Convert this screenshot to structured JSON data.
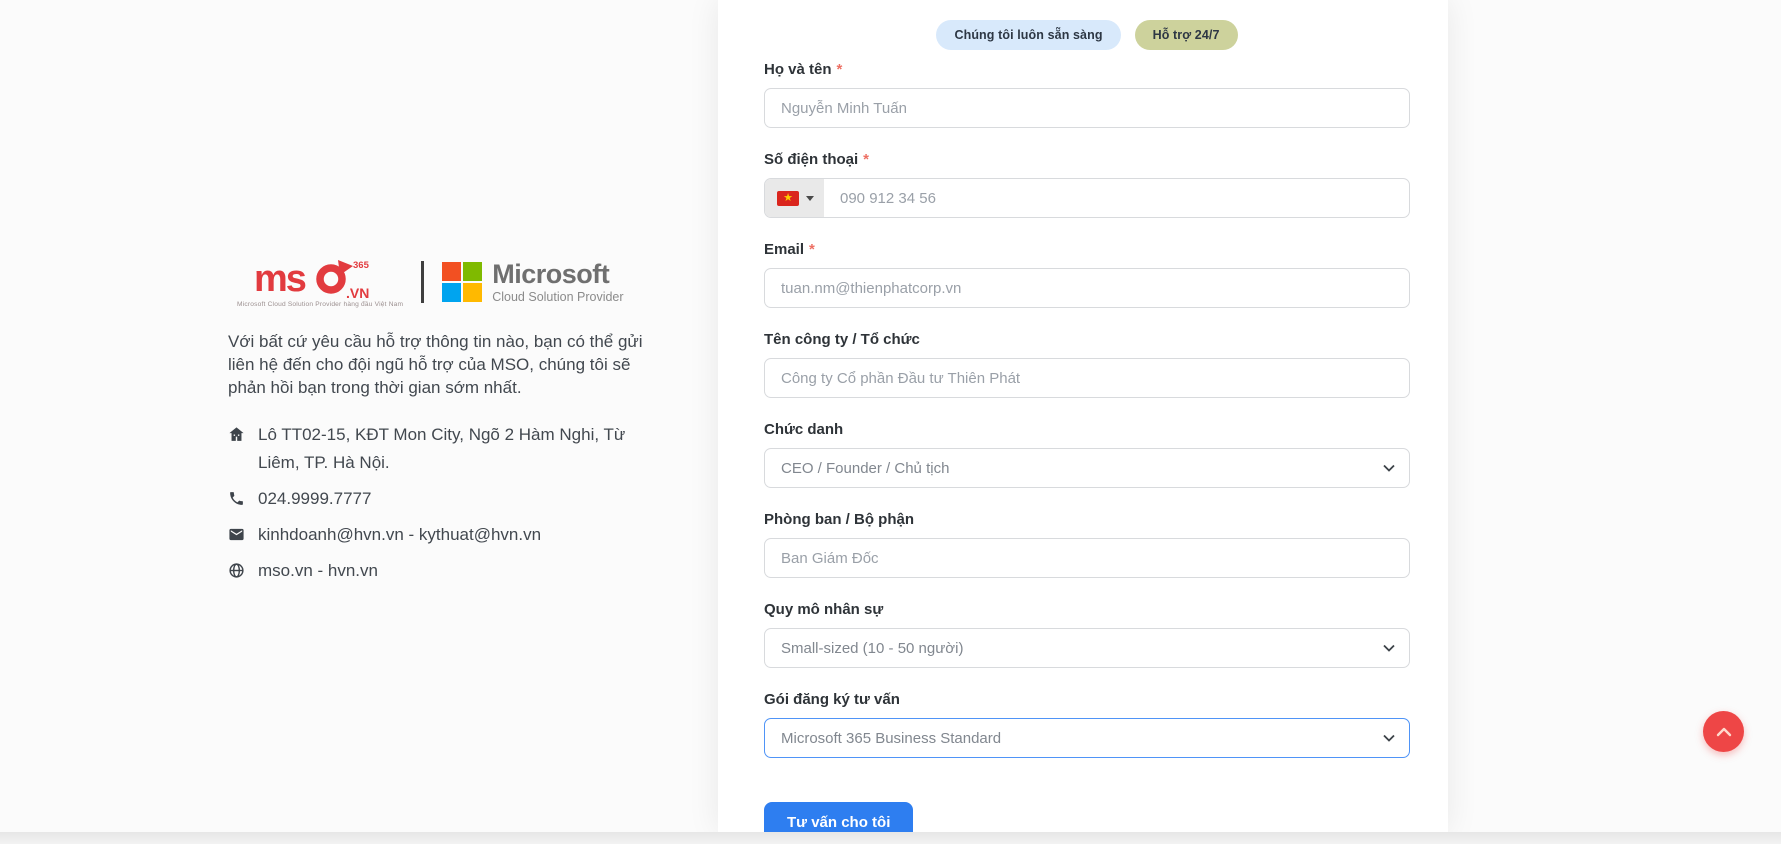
{
  "info_panel": {
    "logo": {
      "mso_text": "ms",
      "mso_365": "365",
      "mso_vn": ".VN",
      "mso_tagline": "Microsoft Cloud Solution Provider hàng đầu Việt Nam",
      "microsoft_name": "Microsoft",
      "microsoft_subtitle": "Cloud Solution Provider",
      "mso_red": "#e23b3f",
      "ms_square_colors": [
        "#f25022",
        "#7fba00",
        "#00a4ef",
        "#ffb900"
      ]
    },
    "description": "Với bất cứ yêu cầu hỗ trợ thông tin nào, bạn có thể gửi liên hệ đến cho đội ngũ hỗ trợ của MSO, chúng tôi sẽ phản hồi bạn trong thời gian sớm nhất.",
    "contacts": [
      {
        "icon": "building-icon",
        "text": "Lô TT02-15, KĐT Mon City, Ngõ 2 Hàm Nghi, Từ Liêm, TP. Hà Nội."
      },
      {
        "icon": "phone-icon",
        "text": "024.9999.7777"
      },
      {
        "icon": "email-icon",
        "text": "kinhdoanh@hvn.vn - kythuat@hvn.vn"
      },
      {
        "icon": "globe-icon",
        "text": "mso.vn - hvn.vn"
      }
    ]
  },
  "form": {
    "required_mark": "*",
    "badges": [
      {
        "label": "Chúng tôi luôn sẵn sàng",
        "bg": "#d8e9fb"
      },
      {
        "label": "Hỗ trợ 24/7",
        "bg": "#cdd29c"
      }
    ],
    "fields": [
      {
        "type": "text",
        "label": "Họ và tên",
        "required": true,
        "placeholder": "Nguyễn Minh Tuấn"
      },
      {
        "type": "phone",
        "label": "Số điện thoại",
        "required": true,
        "placeholder": "090 912 34 56",
        "flag": "vietnam-flag"
      },
      {
        "type": "text",
        "label": "Email",
        "required": true,
        "placeholder": "tuan.nm@thienphatcorp.vn"
      },
      {
        "type": "text",
        "label": "Tên công ty / Tổ chức",
        "required": false,
        "placeholder": "Công ty Cổ phần Đầu tư Thiên Phát"
      },
      {
        "type": "select",
        "label": "Chức danh",
        "required": false,
        "value": "CEO / Founder / Chủ tịch"
      },
      {
        "type": "text",
        "label": "Phòng ban / Bộ phận",
        "required": false,
        "placeholder": "Ban Giám Đốc"
      },
      {
        "type": "select",
        "label": "Quy mô nhân sự",
        "required": false,
        "value": "Small-sized (10 - 50 người)"
      },
      {
        "type": "select",
        "label": "Gói đăng ký tư vấn",
        "required": false,
        "value": "Microsoft 365 Business Standard",
        "focused": true
      }
    ],
    "submit_label": "Tư vấn cho tôi",
    "accent_blue": "#2e7ef0",
    "focus_border": "#4f94f7"
  },
  "scroll_top": {
    "color": "#ee4646"
  }
}
